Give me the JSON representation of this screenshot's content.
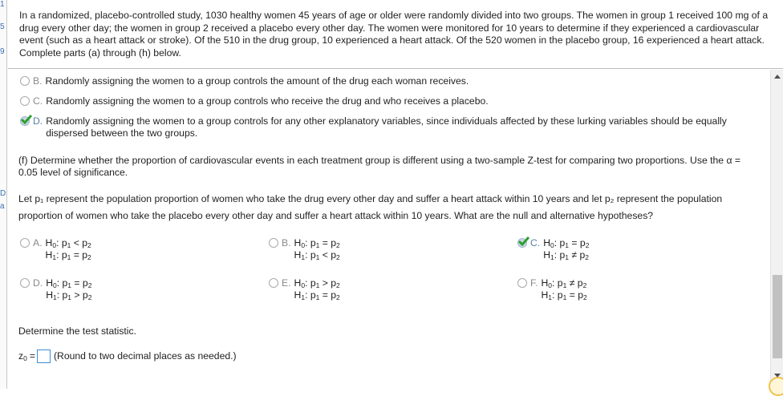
{
  "gutter": [
    "1",
    "5",
    "9",
    "D",
    "a"
  ],
  "intro": "In a randomized, placebo-controlled study, 1030 healthy women 45 years of age or older were randomly divided into two groups. The women in group 1 received 100 mg of a drug every other day; the women in group 2 received a placebo every other day. The women were monitored for 10 years to determine if they experienced a cardiovascular event (such as a heart attack or stroke). Of the 510 in the drug group, 10 experienced a heart attack. Of the 520 women in the placebo group, 16 experienced a heart attack. Complete parts (a) through (h) below.",
  "prev_options": [
    {
      "letter": "B.",
      "text": "Randomly assigning the women to a group controls the amount of the drug each woman receives.",
      "selected": false
    },
    {
      "letter": "C.",
      "text": "Randomly assigning the women to a group controls who receive the drug and who receives a placebo.",
      "selected": false
    },
    {
      "letter": "D.",
      "text": "Randomly assigning the women to a group controls for any other explanatory variables, since individuals affected by these lurking variables should be equally dispersed between the two groups.",
      "selected": true
    }
  ],
  "part_f": "(f) Determine whether the proportion of cardiovascular events in each treatment group is different using a two-sample Z-test for comparing two proportions. Use the α = 0.05 level of significance.",
  "hyp_question": "Let p₁ represent the population proportion of women who take the drug every other day and suffer a heart attack within 10 years and let p₂ represent the population proportion of women who take the placebo every other day and suffer a heart attack within 10 years. What are the null and alternative hypotheses?",
  "hyp_options": [
    {
      "letter": "A.",
      "h0_op": "<",
      "h1_op": "=",
      "selected": false
    },
    {
      "letter": "B.",
      "h0_op": "=",
      "h1_op": "<",
      "selected": false
    },
    {
      "letter": "C.",
      "h0_op": "=",
      "h1_op": "≠",
      "selected": true
    },
    {
      "letter": "D.",
      "h0_op": "=",
      "h1_op": ">",
      "selected": false
    },
    {
      "letter": "E.",
      "h0_op": ">",
      "h1_op": "=",
      "selected": false
    },
    {
      "letter": "F.",
      "h0_op": "≠",
      "h1_op": "=",
      "selected": false
    }
  ],
  "hyp_labels": {
    "h0": "H",
    "h0_sub": "0",
    "h1": "H",
    "h1_sub": "1",
    "p": "p",
    "s1": "1",
    "s2": "2",
    "colon": ":"
  },
  "test_stat_prompt": "Determine the test statistic.",
  "z0_label": "z",
  "z0_sub": "0",
  "z0_eq": "=",
  "z0_value": "",
  "z0_hint": "(Round to two decimal places as needed.)",
  "colors": {
    "check": "#2e9e2e",
    "link": "#3d8fd6"
  }
}
